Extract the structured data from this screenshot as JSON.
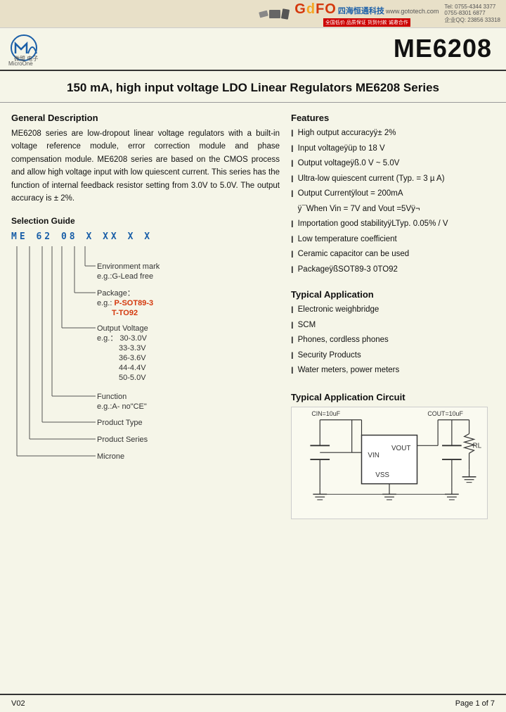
{
  "header": {
    "gofo_logo": "GOFO",
    "gofo_chinese": "四海恒通科技",
    "gofo_website": "www.gototech.com",
    "gofo_tel1": "Tel: 0755-4344 3377",
    "gofo_tel2": "0755-8301 6877",
    "gofo_qq": "企业QQ: 23856 33318"
  },
  "logo": {
    "microne_name": "MicroOne",
    "microne_chinese": "微盟 电子"
  },
  "part_number": "ME6208",
  "main_title": "150 mA, high input voltage LDO Linear Regulators ME6208 Series",
  "general_description": {
    "title": "General Description",
    "text": "ME6208 series are low-dropout linear voltage regulators with a built-in voltage reference module, error correction module and phase compensation module. ME6208 series are based on the CMOS process and allow high voltage input with low quiescent current. This series has the function of internal feedback resistor setting from 3.0V to 5.0V. The output accuracy is ± 2%."
  },
  "features": {
    "title": "Features",
    "items": [
      "High output accuracyÿ± 2%",
      "Input voltageÿüp to 18 V",
      "Output voltageÿß.0 V ~ 5.0V",
      "Ultra-low quiescent current (Typ. = 3 µ A)",
      "Output    Currentÿlout = 200mA",
      "ÿ¯When Vin = 7V and Vout =5Vÿ¬",
      "Importation good stabilityÿLTyp. 0.05% / V",
      "Low temperature coefficient",
      "Ceramic capacitor can be used",
      "PackageÿßSOT89-3  0TO92"
    ]
  },
  "selection_guide": {
    "title": "Selection Guide",
    "code": "ME 62 08 X XX X X",
    "entries": [
      {
        "label": "Environment mark",
        "example": "e.g.:G-Lead free",
        "example_highlight": false
      },
      {
        "label": "Package：",
        "example": "e.g.:  P-SOT89-3",
        "example2": "T-TO92",
        "highlight": "P-SOT89-3",
        "highlight2": "T-TO92"
      },
      {
        "label": "Output Voltage",
        "example": "e.g.：  30-3.0V",
        "example2": "33-3.3V",
        "example3": "36-3.6V",
        "example4": "44-4.4V",
        "example5": "50-5.0V"
      },
      {
        "label": "Function",
        "example": "e.g.:A- no\"CE\""
      },
      {
        "label": "Product Type",
        "example": ""
      },
      {
        "label": "Product Series",
        "example": ""
      },
      {
        "label": "Microne",
        "example": ""
      }
    ]
  },
  "typical_application": {
    "title": "Typical Application",
    "items": [
      "Electronic weighbridge",
      "SCM",
      "Phones, cordless phones",
      "Security Products",
      "Water meters, power meters"
    ]
  },
  "typical_circuit": {
    "title": "Typical Application Circuit",
    "cin_label": "CIN=10uF",
    "cout_label": "COUT=10uF",
    "vin_label": "VIN",
    "vout_label": "VOUT",
    "vss_label": "VSS",
    "rl_label": "RL"
  },
  "footer": {
    "version": "V02",
    "page": "Page 1 of 7"
  }
}
